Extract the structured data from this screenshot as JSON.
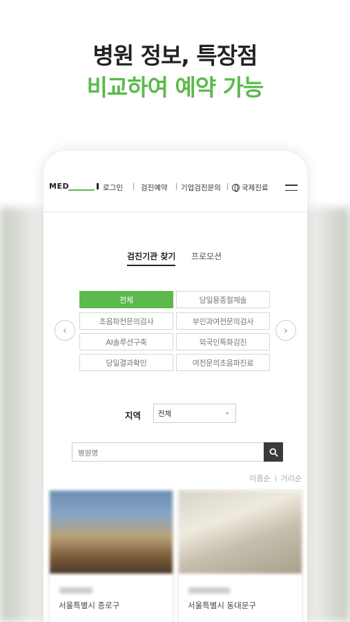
{
  "headline": {
    "line1": "병원 정보, 특장점",
    "line2": "비교하여 예약 가능"
  },
  "colors": {
    "accent": "#5cb94c",
    "text": "#222222"
  },
  "app": {
    "logo": "MED",
    "nav": {
      "login": "로그인",
      "checkup_reservation": "검진예약",
      "corporate_inquiry": "기업검진문의",
      "international": "국제진료"
    },
    "tabs": [
      {
        "label": "검진기관 찾기",
        "active": true
      },
      {
        "label": "프로모션",
        "active": false
      }
    ],
    "categories": [
      {
        "label": "전체",
        "active": true
      },
      {
        "label": "당일용종절제술",
        "active": false
      },
      {
        "label": "초음파전문의검사",
        "active": false
      },
      {
        "label": "부인과여전문의검사",
        "active": false
      },
      {
        "label": "AI솔루션구축",
        "active": false
      },
      {
        "label": "외국인특화검진",
        "active": false
      },
      {
        "label": "당일결과확인",
        "active": false
      },
      {
        "label": "여전문의초음파진료",
        "active": false
      }
    ],
    "region": {
      "label": "지역",
      "selected": "전체"
    },
    "search": {
      "placeholder": "병원명"
    },
    "sort": {
      "by_name": "이름순",
      "by_distance": "거리순"
    },
    "cards": [
      {
        "address": "서울특별시 종로구"
      },
      {
        "address": "서울특별시 동대문구"
      }
    ],
    "icons": {
      "prev": "chevron-left-icon",
      "next": "chevron-right-icon",
      "search": "search-icon",
      "menu": "hamburger-icon",
      "globe": "globe-icon"
    }
  }
}
